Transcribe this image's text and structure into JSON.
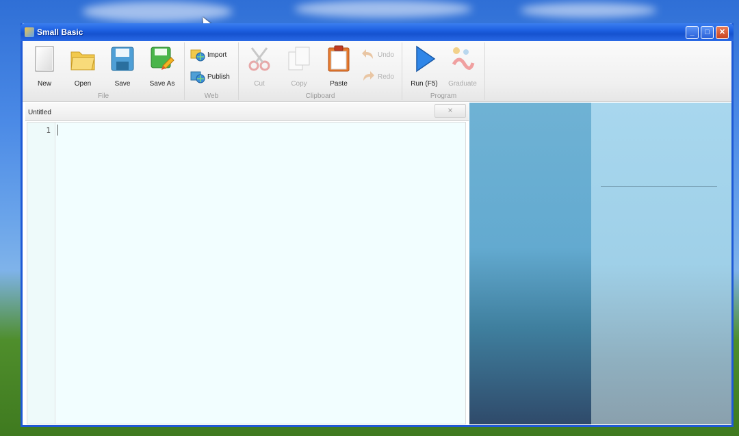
{
  "window": {
    "title": "Small Basic",
    "controls": {
      "minimize": "_",
      "maximize": "□",
      "close": "✕"
    }
  },
  "ribbon": {
    "groups": {
      "file": {
        "label": "File",
        "new": "New",
        "open": "Open",
        "save": "Save",
        "save_as": "Save As"
      },
      "web": {
        "label": "Web",
        "import": "Import",
        "publish": "Publish"
      },
      "clipboard": {
        "label": "Clipboard",
        "cut": "Cut",
        "copy": "Copy",
        "paste": "Paste",
        "undo": "Undo",
        "redo": "Redo"
      },
      "program": {
        "label": "Program",
        "run": "Run (F5)",
        "graduate": "Graduate"
      }
    }
  },
  "editor": {
    "tab_title": "Untitled",
    "tab_close": "×",
    "line_numbers": [
      "1"
    ]
  },
  "colors": {
    "titlebar": "#1d5fe0",
    "editor_bg": "#f2feff",
    "accent_play": "#2f86e8"
  }
}
